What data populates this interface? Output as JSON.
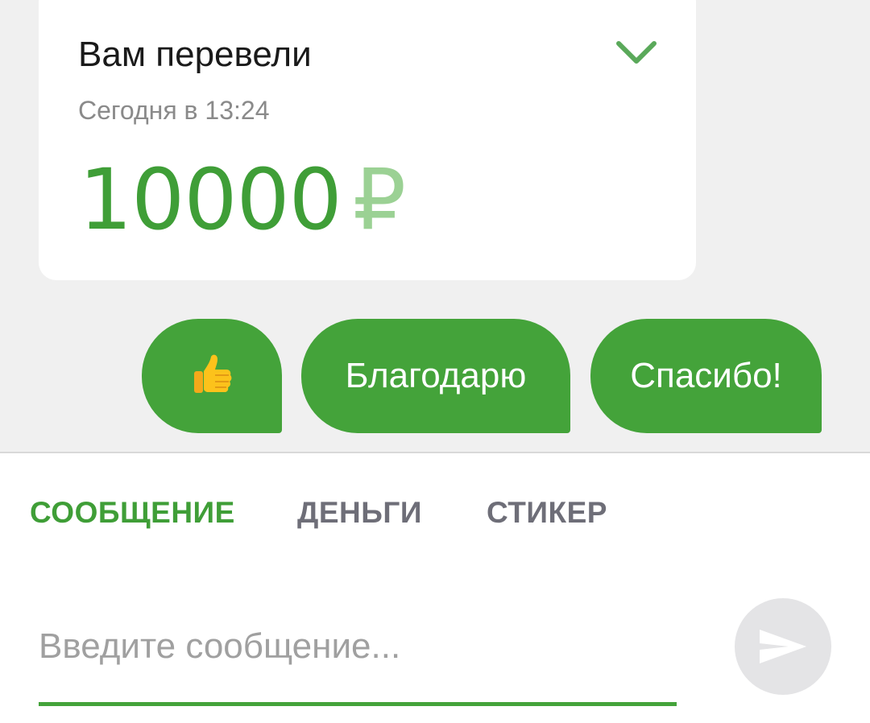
{
  "transfer_card": {
    "title": "Вам перевели",
    "time": "Сегодня в 13:24",
    "amount": "10000",
    "currency": "₽",
    "expand_icon": "chevron-down-icon"
  },
  "quick_replies": {
    "items": [
      {
        "icon": "thumbs-up-icon",
        "label": ""
      },
      {
        "label": "Благодарю"
      },
      {
        "label": "Спасибо!"
      }
    ]
  },
  "tabs": [
    {
      "label": "СООБЩЕНИЕ",
      "active": true
    },
    {
      "label": "ДЕНЬГИ",
      "active": false
    },
    {
      "label": "СТИКЕР",
      "active": false
    }
  ],
  "composer": {
    "placeholder": "Введите сообщение...",
    "value": "",
    "send_icon": "send-icon"
  },
  "colors": {
    "accent": "#44a33a",
    "amount_green": "#3f9e37",
    "currency_light_green": "#9bd194",
    "background": "#f0f0f0",
    "tab_inactive": "#6e6e78",
    "send_button_bg": "#e4e4e6"
  }
}
